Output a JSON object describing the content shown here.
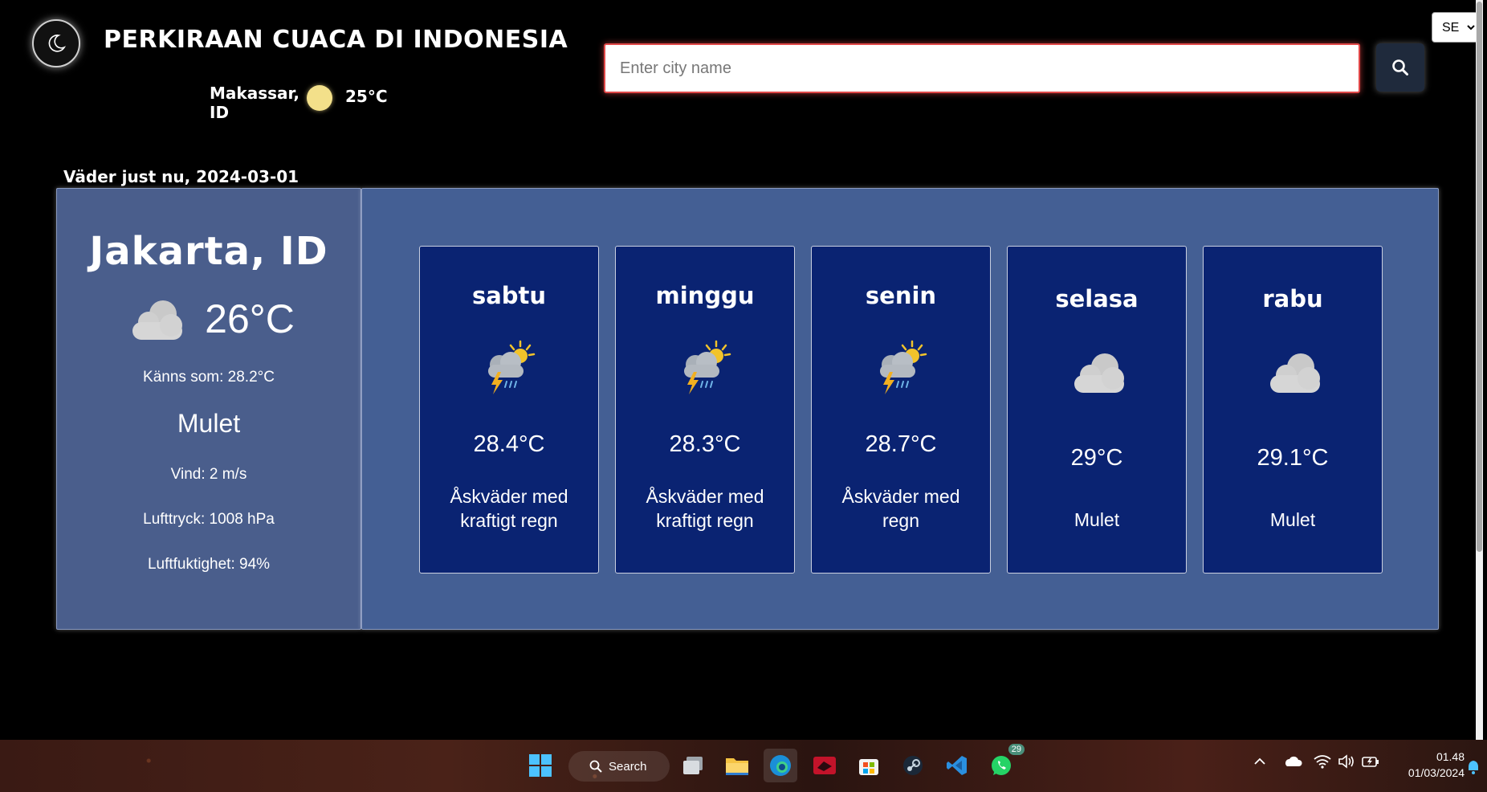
{
  "header": {
    "title": "PERKIRAAN CUACA DI INDONESIA",
    "theme_toggle_icon": "moon-icon"
  },
  "quick_weather": {
    "city": "Makassar, ID",
    "icon": "sun-icon",
    "temp": "25°C"
  },
  "search": {
    "placeholder": "Enter city name",
    "value": "",
    "button_icon": "search-icon"
  },
  "language": {
    "selected": "SE",
    "options": [
      "SE"
    ]
  },
  "current": {
    "heading": "Väder just nu, 2024-03-01",
    "city": "Jakarta, ID",
    "icon": "cloud-icon",
    "temp": "26°C",
    "feels_like": "Känns som: 28.2°C",
    "description": "Mulet",
    "wind": "Vind: 2 m/s",
    "pressure": "Lufttryck: 1008 hPa",
    "humidity": "Luftfuktighet: 94%"
  },
  "forecast": [
    {
      "day": "sabtu",
      "icon": "thunderstorm-icon",
      "temp": "28.4°C",
      "desc": "Åskväder med kraftigt regn"
    },
    {
      "day": "minggu",
      "icon": "thunderstorm-icon",
      "temp": "28.3°C",
      "desc": "Åskväder med kraftigt regn"
    },
    {
      "day": "senin",
      "icon": "thunderstorm-icon",
      "temp": "28.7°C",
      "desc": "Åskväder med regn"
    },
    {
      "day": "selasa",
      "icon": "cloud-icon",
      "temp": "29°C",
      "desc": "Mulet"
    },
    {
      "day": "rabu",
      "icon": "cloud-icon",
      "temp": "29.1°C",
      "desc": "Mulet"
    }
  ],
  "taskbar": {
    "search_label": "Search",
    "whatsapp_badge": "29",
    "clock_time": "01.48",
    "clock_date": "01/03/2024",
    "apps": [
      "start-icon",
      "search-icon",
      "task-view-icon",
      "file-explorer-icon",
      "edge-icon",
      "app-icon",
      "store-icon",
      "steam-icon",
      "vscode-icon",
      "whatsapp-icon"
    ],
    "tray": [
      "chevron-up-icon",
      "onedrive-icon",
      "wifi-icon",
      "volume-icon",
      "battery-icon",
      "notification-bell-icon"
    ]
  },
  "colors": {
    "page_bg": "#000000",
    "current_panel": "#4a5e8c",
    "forecast_panel": "#445f94",
    "forecast_card": "#0a2372",
    "search_border": "#e04848"
  }
}
